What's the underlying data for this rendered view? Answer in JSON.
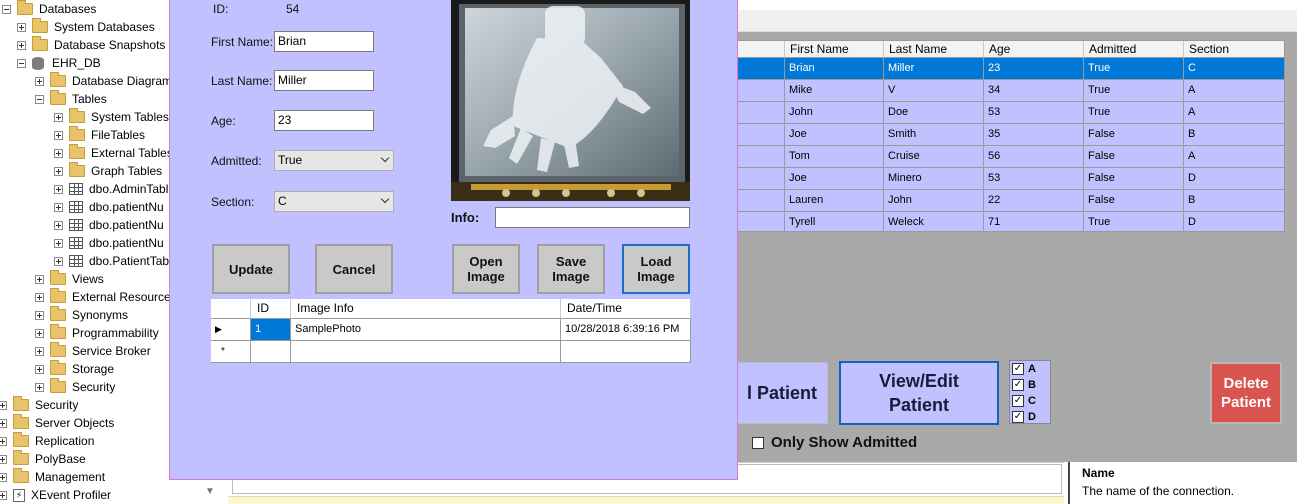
{
  "object_explorer": {
    "items": [
      {
        "label": "Databases"
      },
      {
        "label": "System Databases"
      },
      {
        "label": "Database Snapshots"
      },
      {
        "label": "EHR_DB"
      },
      {
        "label": "Database Diagrams"
      },
      {
        "label": "Tables"
      },
      {
        "label": "System Tables"
      },
      {
        "label": "FileTables"
      },
      {
        "label": "External Tables"
      },
      {
        "label": "Graph Tables"
      },
      {
        "label": "dbo.AdminTable"
      },
      {
        "label": "dbo.patientNu"
      },
      {
        "label": "dbo.patientNu"
      },
      {
        "label": "dbo.patientNu"
      },
      {
        "label": "dbo.PatientTable"
      },
      {
        "label": "Views"
      },
      {
        "label": "External Resources"
      },
      {
        "label": "Synonyms"
      },
      {
        "label": "Programmability"
      },
      {
        "label": "Service Broker"
      },
      {
        "label": "Storage"
      },
      {
        "label": "Security"
      },
      {
        "label": "Security"
      },
      {
        "label": "Server Objects"
      },
      {
        "label": "Replication"
      },
      {
        "label": "PolyBase"
      },
      {
        "label": "Management"
      },
      {
        "label": "XEvent Profiler"
      }
    ]
  },
  "patient_grid": {
    "columns": [
      "First Name",
      "Last Name",
      "Age",
      "Admitted",
      "Section"
    ],
    "rows": [
      [
        "Brian",
        "Miller",
        "23",
        "True",
        "C"
      ],
      [
        "Mike",
        "V",
        "34",
        "True",
        "A"
      ],
      [
        "John",
        "Doe",
        "53",
        "True",
        "A"
      ],
      [
        "Joe",
        "Smith",
        "35",
        "False",
        "B"
      ],
      [
        "Tom",
        "Cruise",
        "56",
        "False",
        "A"
      ],
      [
        "Joe",
        "Minero",
        "53",
        "False",
        "D"
      ],
      [
        "Lauren",
        "John",
        "22",
        "False",
        "B"
      ],
      [
        "Tyrell",
        "Weleck",
        "71",
        "True",
        "D"
      ]
    ],
    "selected_row": 0
  },
  "main_buttons": {
    "add_label": "l Patient",
    "view_edit_label": "View/Edit Patient",
    "delete_label": "Delete Patient"
  },
  "section_filters": [
    {
      "label": "A",
      "checked": true
    },
    {
      "label": "B",
      "checked": true
    },
    {
      "label": "C",
      "checked": true
    },
    {
      "label": "D",
      "checked": true
    }
  ],
  "only_admitted": {
    "label": "Only Show Admitted",
    "checked": false
  },
  "properties": {
    "name_label": "Name",
    "description": "The name of the connection."
  },
  "dialog": {
    "id_label": "ID:",
    "id_value": "54",
    "first_name_label": "First Name:",
    "first_name": "Brian",
    "last_name_label": "Last Name:",
    "last_name": "Miller",
    "age_label": "Age:",
    "age": "23",
    "admitted_label": "Admitted:",
    "admitted": "True",
    "section_label": "Section:",
    "section": "C",
    "info_label": "Info:",
    "info_value": "",
    "buttons": {
      "update": "Update",
      "cancel": "Cancel",
      "open_image": "Open Image",
      "save_image": "Save Image",
      "load_image": "Load Image"
    },
    "image_grid": {
      "columns": [
        "ID",
        "Image Info",
        "Date/Time"
      ],
      "rows": [
        [
          "1",
          "SamplePhoto",
          "10/28/2018 6:39:16 PM"
        ]
      ],
      "new_row_marker": "*"
    }
  },
  "colors": {
    "form_background": "#c1c1ff",
    "selection": "#0078d7",
    "delete_button": "#d9534f",
    "app_background": "#a9a9a9"
  }
}
